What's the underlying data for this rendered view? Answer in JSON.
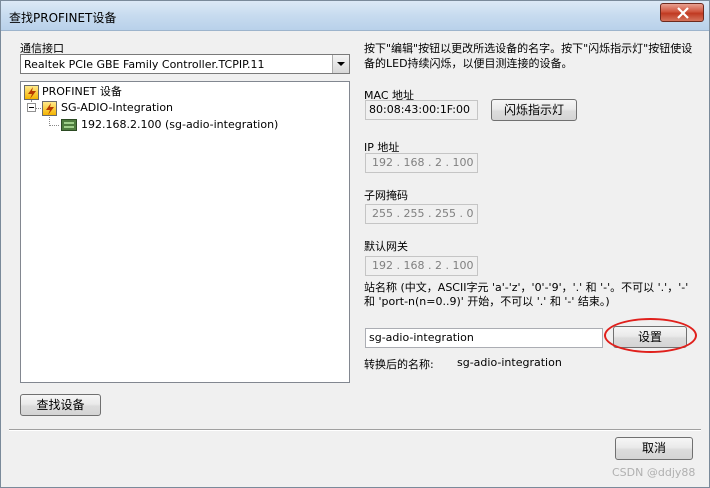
{
  "window": {
    "title": "查找PROFINET设备",
    "close_label": "✕"
  },
  "interface": {
    "label": "通信接口",
    "selected": "Realtek PCIe GBE Family Controller.TCPIP.11"
  },
  "tree": {
    "root": "PROFINET 设备",
    "group": "SG-ADIO-Integration",
    "device": "192.168.2.100 (sg-adio-integration)"
  },
  "search_button": "查找设备",
  "help_text": "按下\"编辑\"按钮以更改所选设备的名字。按下\"闪烁指示灯\"按钮使设备的LED持续闪烁，以便目测连接的设备。",
  "mac": {
    "label": "MAC 地址",
    "value": "80:08:43:00:1F:00",
    "flash_button": "闪烁指示灯"
  },
  "ip": {
    "label": "IP 地址",
    "value": "192 . 168 .  2  . 100"
  },
  "subnet": {
    "label": "子网掩码",
    "value": "255 . 255 . 255 .  0"
  },
  "gateway": {
    "label": "默认网关",
    "value": "192 . 168 .  2  . 100"
  },
  "station": {
    "rule_text": "站名称 (中文，ASCII字元 'a'-'z'，'0'-'9'，'.' 和 '-'。不可以 '.'，'-' 和 'port-n(n=0..9)' 开始，不可以 '.' 和 '-' 结束。)",
    "value": "sg-adio-integration",
    "set_button": "设置",
    "converted_label": "转换后的名称:",
    "converted_value": "sg-adio-integration"
  },
  "cancel_button": "取消",
  "watermark": "CSDN @ddjy88",
  "colors": {
    "highlight_ring": "#e0201c",
    "titlebar": "#c7dbef",
    "close": "#c03a22"
  }
}
